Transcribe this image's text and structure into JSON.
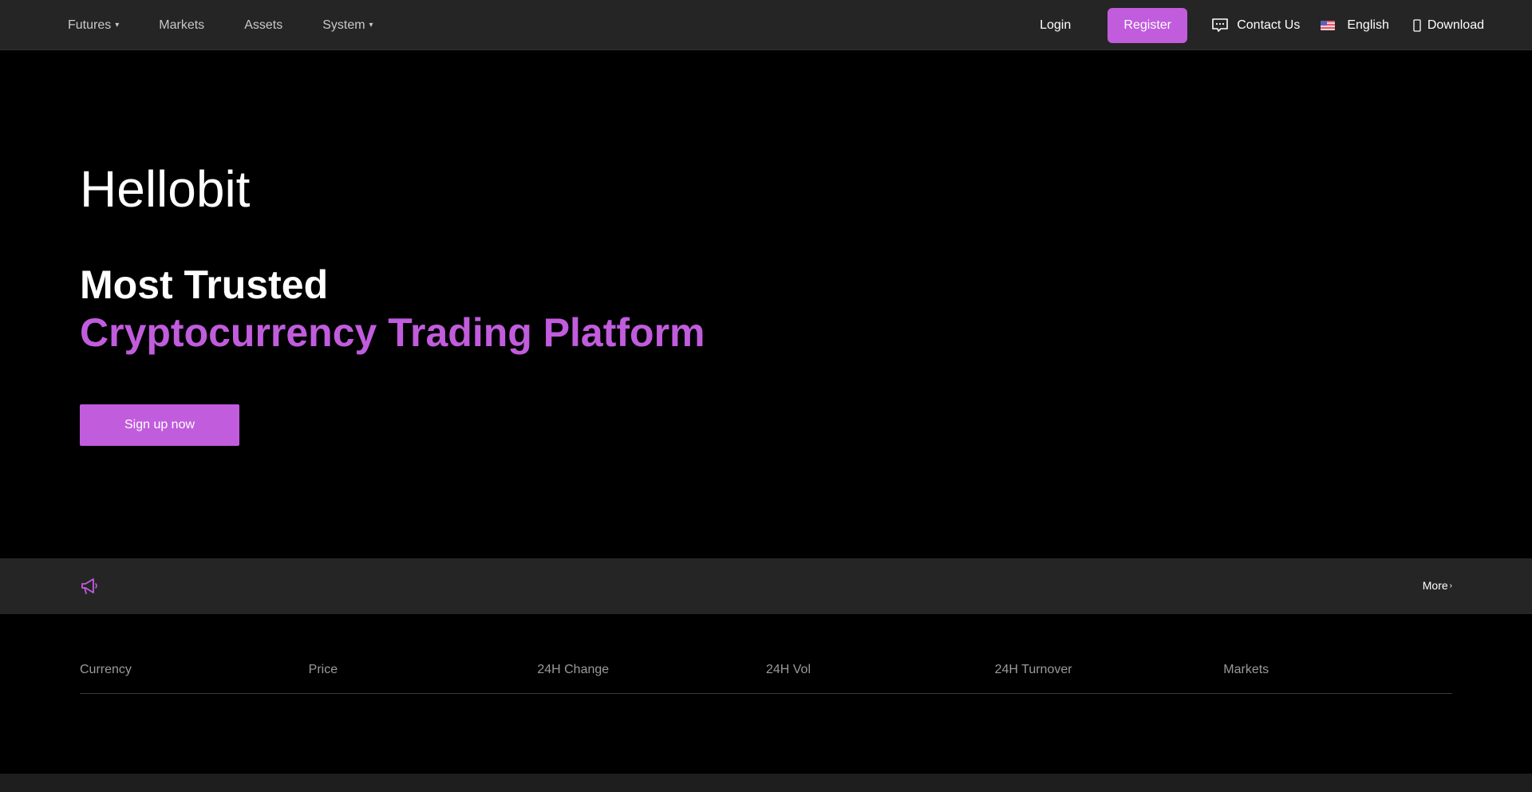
{
  "nav": {
    "left": [
      {
        "label": "Futures",
        "has_caret": true
      },
      {
        "label": "Markets",
        "has_caret": false
      },
      {
        "label": "Assets",
        "has_caret": false
      },
      {
        "label": "System",
        "has_caret": true
      }
    ],
    "login": "Login",
    "register": "Register",
    "contact": "Contact Us",
    "language": "English",
    "download": "Download",
    "caret_glyph": "▾"
  },
  "hero": {
    "brand": "Hellobit",
    "line1": "Most Trusted",
    "line2": "Cryptocurrency Trading Platform",
    "cta": "Sign up now"
  },
  "notice": {
    "more": "More",
    "more_arrow": "›"
  },
  "table": {
    "columns": [
      "Currency",
      "Price",
      "24H Change",
      "24H Vol",
      "24H Turnover",
      "Markets"
    ]
  },
  "colors": {
    "accent": "#c15cdd",
    "bar_bg": "#252525",
    "page_bg": "#000000"
  },
  "icons": {
    "contact": "chat-bubble-icon",
    "language": "us-flag-icon",
    "download": "apple-icon",
    "notice": "megaphone-icon"
  }
}
